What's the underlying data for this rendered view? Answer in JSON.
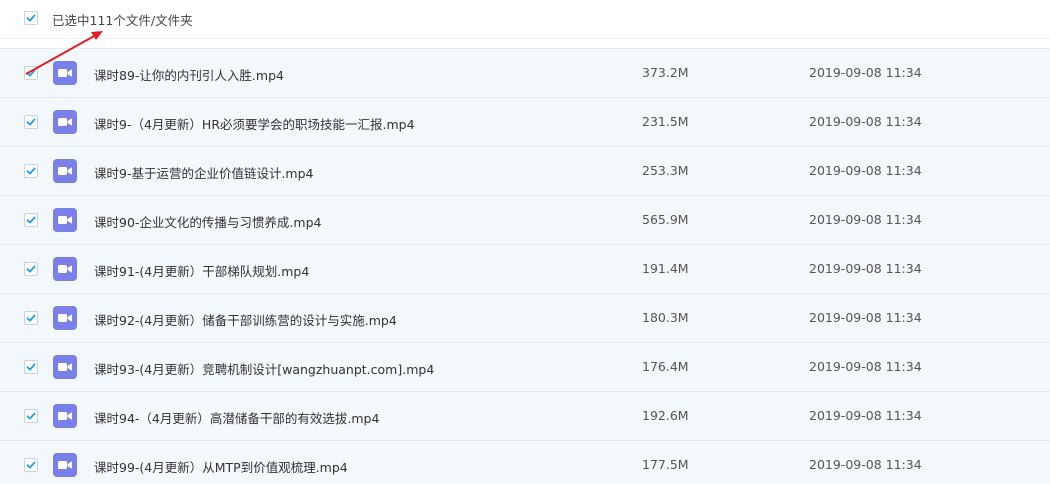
{
  "selection": {
    "summary": "已选中111个文件/文件夹",
    "checked": true
  },
  "colors": {
    "checkbox_tick": "#1f9eef",
    "row_bg": "#f3f8fd",
    "video_icon": "#7b7fe8",
    "annotation_arrow": "#e02020"
  },
  "icons": {
    "file_type": "video-file-icon",
    "check": "checkmark-icon",
    "annotation": "red-arrow-annotation"
  },
  "files": [
    {
      "name": "课时89-让你的内刊引人入胜.mp4",
      "size": "373.2M",
      "date": "2019-09-08 11:34",
      "checked": true
    },
    {
      "name": "课时9-（4月更新）HR必须要学会的职场技能一汇报.mp4",
      "size": "231.5M",
      "date": "2019-09-08 11:34",
      "checked": true
    },
    {
      "name": "课时9-基于运营的企业价值链设计.mp4",
      "size": "253.3M",
      "date": "2019-09-08 11:34",
      "checked": true
    },
    {
      "name": "课时90-企业文化的传播与习惯养成.mp4",
      "size": "565.9M",
      "date": "2019-09-08 11:34",
      "checked": true
    },
    {
      "name": "课时91-(4月更新）干部梯队规划.mp4",
      "size": "191.4M",
      "date": "2019-09-08 11:34",
      "checked": true
    },
    {
      "name": "课时92-(4月更新）储备干部训练营的设计与实施.mp4",
      "size": "180.3M",
      "date": "2019-09-08 11:34",
      "checked": true
    },
    {
      "name": "课时93-(4月更新）竞聘机制设计[wangzhuanpt.com].mp4",
      "size": "176.4M",
      "date": "2019-09-08 11:34",
      "checked": true
    },
    {
      "name": "课时94-（4月更新）高潜储备干部的有效选拔.mp4",
      "size": "192.6M",
      "date": "2019-09-08 11:34",
      "checked": true
    },
    {
      "name": "课时99-(4月更新）从MTP到价值观梳理.mp4",
      "size": "177.5M",
      "date": "2019-09-08 11:34",
      "checked": true
    }
  ]
}
